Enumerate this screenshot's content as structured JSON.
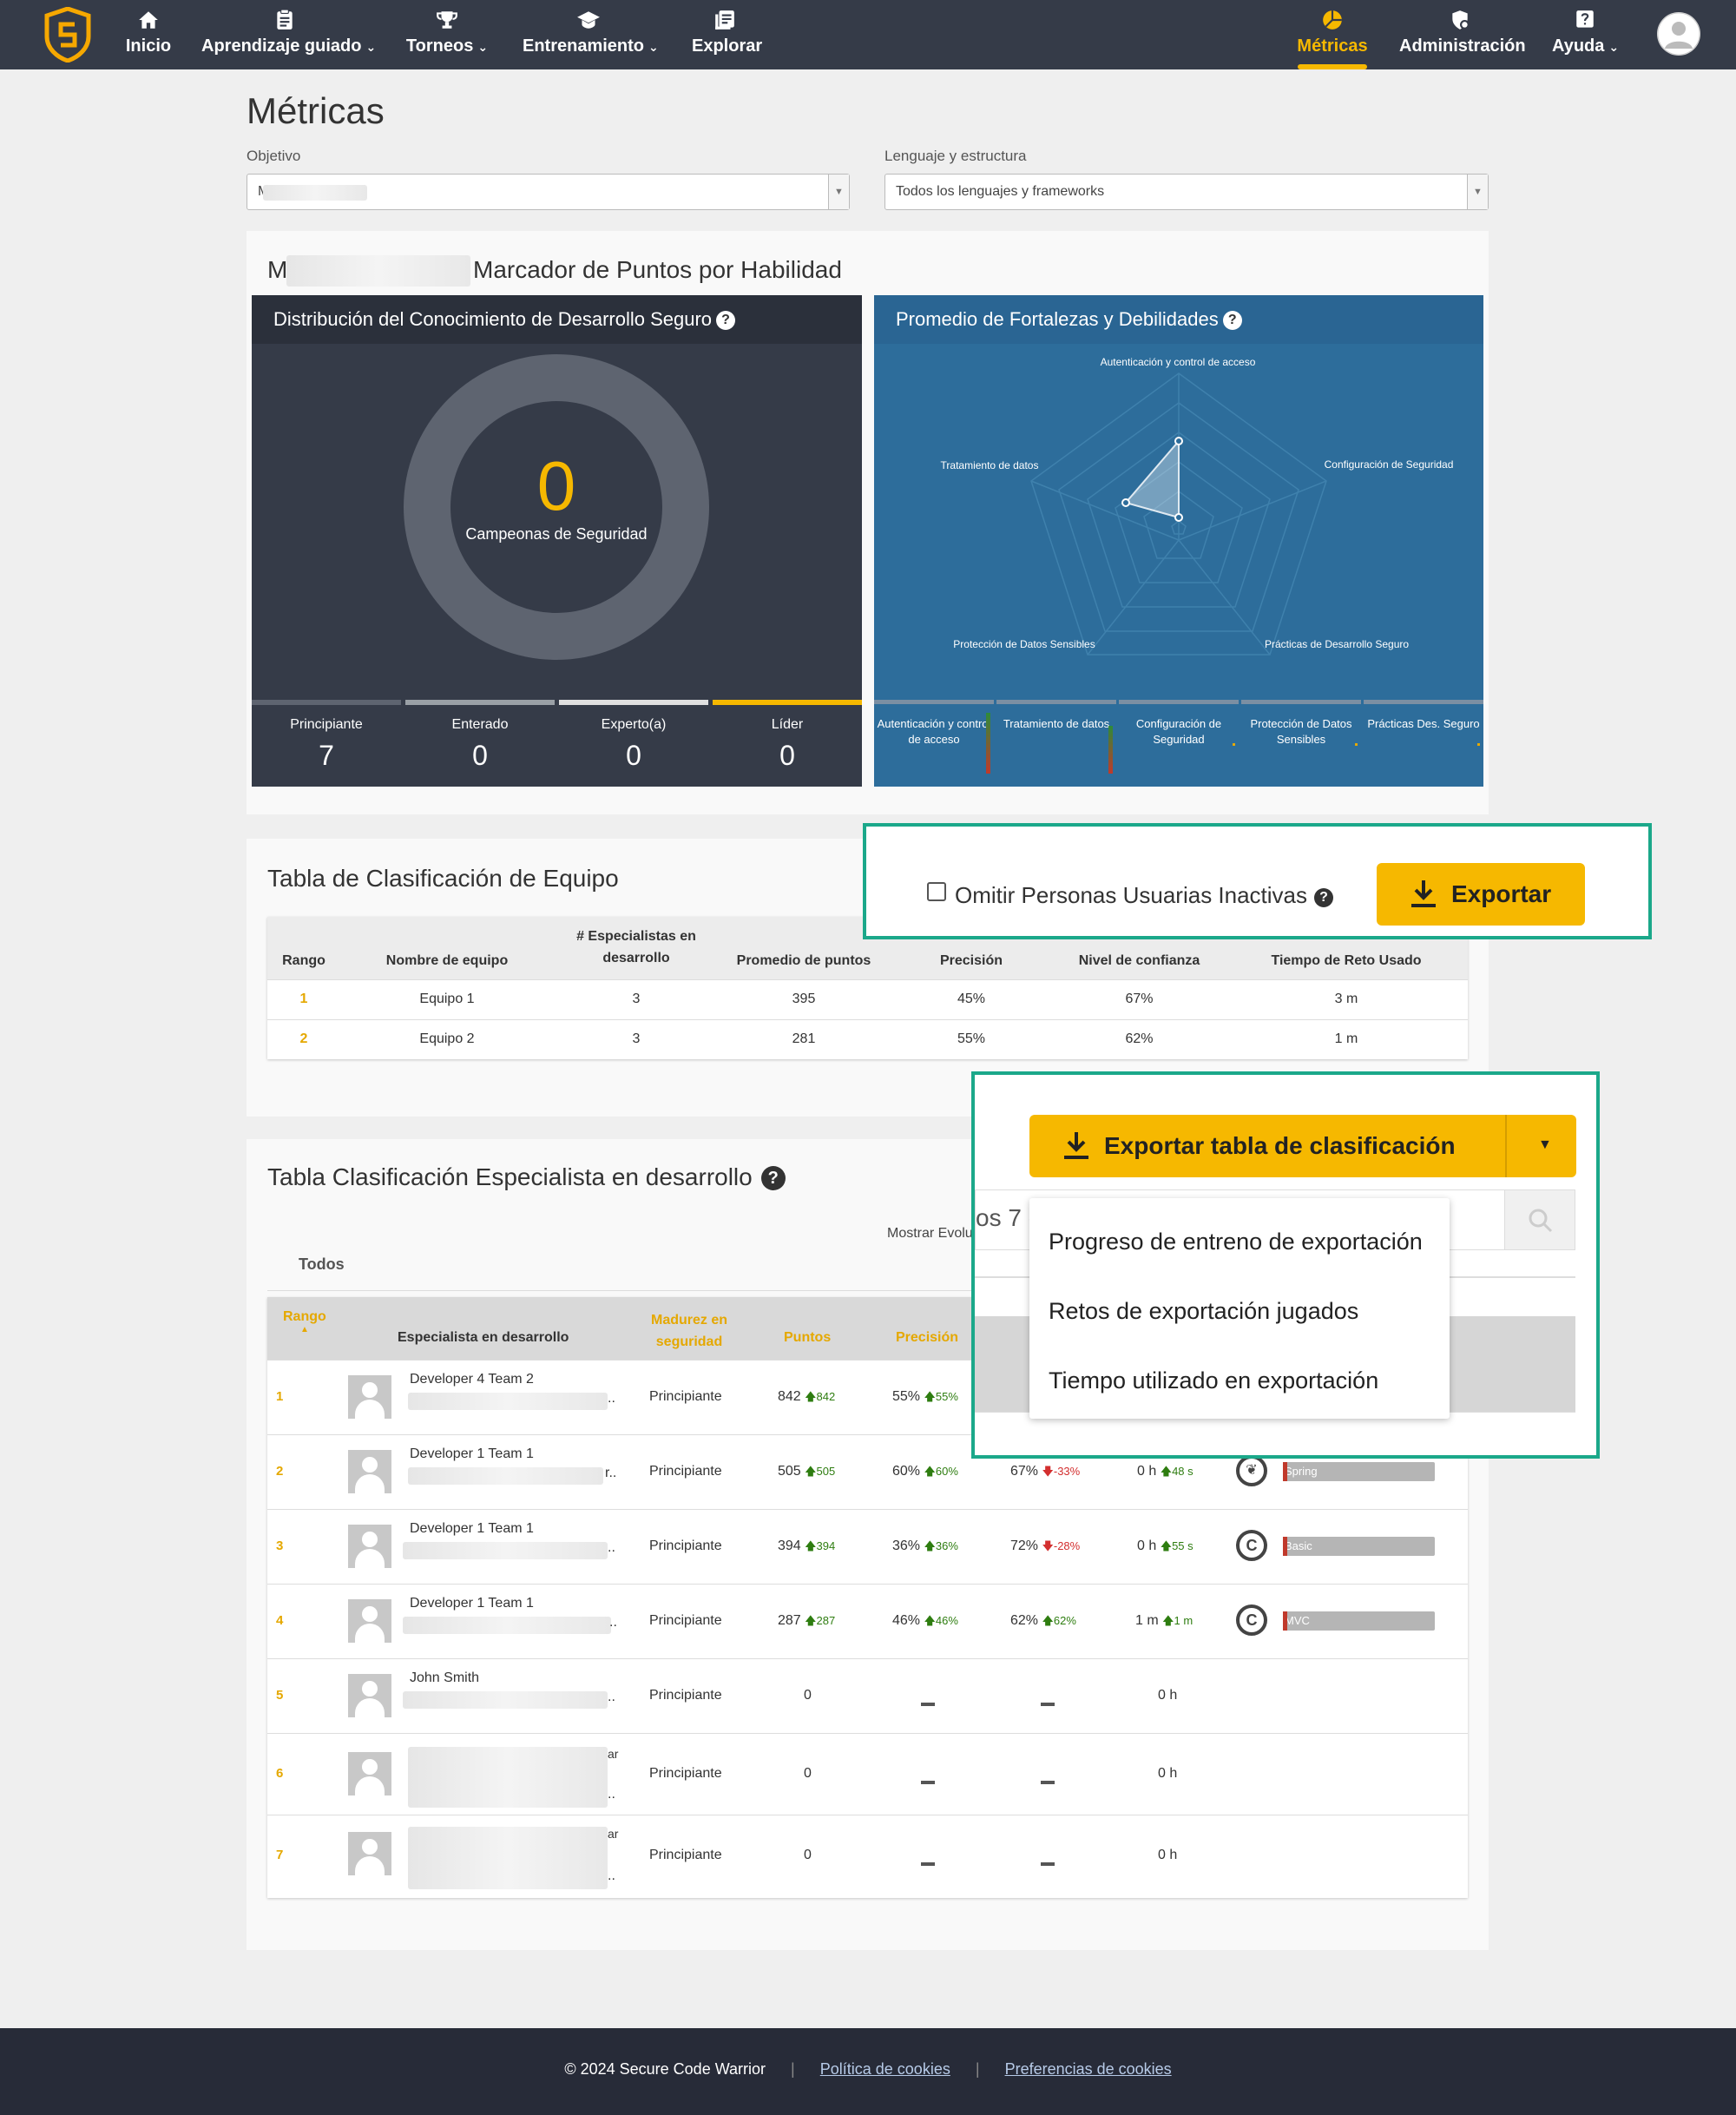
{
  "nav": {
    "items": [
      {
        "label": "Inicio",
        "icon": "home-icon"
      },
      {
        "label": "Aprendizaje guiado",
        "icon": "clipboard-icon"
      },
      {
        "label": "Torneos",
        "icon": "trophy-icon"
      },
      {
        "label": "Entrenamiento",
        "icon": "graduation-cap-icon"
      },
      {
        "label": "Explorar",
        "icon": "library-icon"
      }
    ],
    "right": [
      {
        "label": "Métricas",
        "icon": "pie-chart-icon"
      },
      {
        "label": "Administración",
        "icon": "admin-shield-icon"
      },
      {
        "label": "Ayuda",
        "icon": "help-icon"
      }
    ]
  },
  "page": {
    "title": "Métricas"
  },
  "filters": {
    "objetivo_label": "Objetivo",
    "objetivo_value": "M",
    "lenguaje_label": "Lenguaje y estructura",
    "lenguaje_value": "Todos los lenguajes y frameworks"
  },
  "scoreboard": {
    "title_prefix": "M",
    "title": "Marcador de Puntos por Habilidad",
    "distribution": {
      "title": "Distribución del Conocimiento de Desarrollo Seguro",
      "center_value": "0",
      "center_label": "Campeonas de Seguridad",
      "levels": [
        {
          "label": "Principiante",
          "value": "7",
          "color": "#5e6470"
        },
        {
          "label": "Enterado",
          "value": "0",
          "color": "#9aa0a6"
        },
        {
          "label": "Experto(a)",
          "value": "0",
          "color": "#e0e0e0"
        },
        {
          "label": "Líder",
          "value": "0",
          "color": "#f6b800"
        }
      ]
    },
    "radar": {
      "title": "Promedio de Fortalezas y Debilidades",
      "axes": [
        "Autenticación y control de acceso",
        "Configuración de Seguridad",
        "Prácticas de Desarrollo Seguro",
        "Protección de Datos Sensibles",
        "Tratamiento de datos"
      ],
      "short": [
        "Autenticación y control de acceso",
        "Tratamiento de datos",
        "Configuración de Seguridad",
        "Protección de Datos Sensibles",
        "Prácticas Des. Seguro"
      ]
    }
  },
  "team_table": {
    "title": "Tabla de Clasificación de Equipo",
    "omit_label": "Omitir Personas Usuarias Inactivas",
    "export_label": "Exportar",
    "headers": [
      "Rango",
      "Nombre de equipo",
      "# Especialistas en desarrollo",
      "Promedio de puntos",
      "Precisión",
      "Nivel de confianza",
      "Tiempo de Reto Usado"
    ],
    "rows": [
      [
        "1",
        "Equipo 1",
        "3",
        "395",
        "45%",
        "67%",
        "3 m"
      ],
      [
        "2",
        "Equipo 2",
        "3",
        "281",
        "55%",
        "62%",
        "1 m"
      ]
    ]
  },
  "dev_table": {
    "title": "Tabla Clasificación Especialista en desarrollo",
    "filter_tab": "Todos",
    "show_evol": "Mostrar Evolu",
    "search_partial": "os 7 c",
    "export_label": "Exportar tabla de clasificación",
    "menu": [
      "Progreso de entreno de exportación",
      "Retos de exportación jugados",
      "Tiempo utilizado en exportación"
    ],
    "headers": {
      "rank": "Rango",
      "dev": "Especialista en desarrollo",
      "maturity": "Madurez en seguridad",
      "points": "Puntos",
      "precision": "Precisión"
    },
    "rows": [
      {
        "rank": "1",
        "name": "Developer 4 Team 2",
        "maturity": "Principiante",
        "points": "842",
        "points_delta": "842",
        "prec": "55%",
        "prec_delta": "55%"
      },
      {
        "rank": "2",
        "name": "Developer 1 Team 1",
        "maturity": "Principiante",
        "points": "505",
        "points_delta": "505",
        "prec": "60%",
        "prec_delta": "60%",
        "conf": "67%",
        "conf_delta": "-33%",
        "time": "0 h",
        "time_delta": "48 s",
        "lang": "Spring"
      },
      {
        "rank": "3",
        "name": "Developer 1 Team 1",
        "maturity": "Principiante",
        "points": "394",
        "points_delta": "394",
        "prec": "36%",
        "prec_delta": "36%",
        "conf": "72%",
        "conf_delta": "-28%",
        "time": "0 h",
        "time_delta": "55 s",
        "lang": "Basic"
      },
      {
        "rank": "4",
        "name": "Developer 1 Team 1",
        "maturity": "Principiante",
        "points": "287",
        "points_delta": "287",
        "prec": "46%",
        "prec_delta": "46%",
        "conf": "62%",
        "conf_delta": "62%",
        "time": "1 m",
        "time_delta": "1 m",
        "lang": "MVC"
      },
      {
        "rank": "5",
        "name": "John Smith",
        "maturity": "Principiante",
        "points": "0",
        "time": "0 h"
      },
      {
        "rank": "6",
        "name": "",
        "maturity": "Principiante",
        "points": "0",
        "time": "0 h"
      },
      {
        "rank": "7",
        "name": "",
        "maturity": "Principiante",
        "points": "0",
        "time": "0 h"
      }
    ]
  },
  "footer": {
    "copyright": "© 2024 Secure Code Warrior",
    "sep": "|",
    "cookie_policy": "Política de cookies",
    "cookie_prefs": "Preferencias de cookies"
  }
}
